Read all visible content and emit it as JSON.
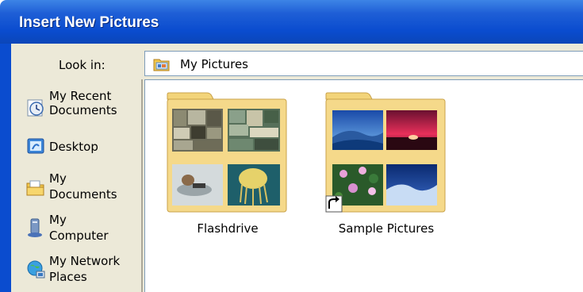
{
  "window": {
    "title": "Insert New Pictures"
  },
  "lookin": {
    "label": "Look in:",
    "value": "My Pictures",
    "icon": "folder-icon"
  },
  "places": [
    {
      "label_line1": "My Recent",
      "label_line2": "Documents",
      "icon": "recent-documents-icon"
    },
    {
      "label_line1": "Desktop",
      "label_line2": "",
      "icon": "desktop-icon"
    },
    {
      "label_line1": "My",
      "label_line2": "Documents",
      "icon": "my-documents-icon"
    },
    {
      "label_line1": "My",
      "label_line2": "Computer",
      "icon": "my-computer-icon"
    },
    {
      "label_line1": "My Network",
      "label_line2": "Places",
      "icon": "network-places-icon"
    }
  ],
  "folders": [
    {
      "name": "Flashdrive",
      "shortcut": false
    },
    {
      "name": "Sample Pictures",
      "shortcut": true
    }
  ],
  "colors": {
    "titlebar": "#0a4ccf",
    "dialog_bg": "#ece9d8",
    "folder_yellow": "#f5d98a"
  }
}
